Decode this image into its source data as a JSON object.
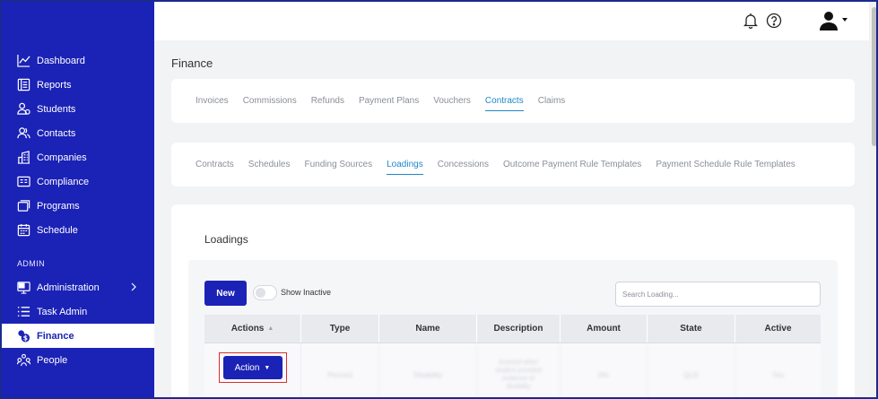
{
  "sidebar": {
    "items": [
      {
        "label": "Dashboard",
        "icon": "chart-line-icon"
      },
      {
        "label": "Reports",
        "icon": "report-icon"
      },
      {
        "label": "Students",
        "icon": "students-icon"
      },
      {
        "label": "Contacts",
        "icon": "contacts-icon"
      },
      {
        "label": "Companies",
        "icon": "companies-icon"
      },
      {
        "label": "Compliance",
        "icon": "compliance-icon"
      },
      {
        "label": "Programs",
        "icon": "programs-icon"
      },
      {
        "label": "Schedule",
        "icon": "calendar-icon"
      }
    ],
    "section_label": "ADMIN",
    "admin_items": [
      {
        "label": "Administration",
        "icon": "monitor-icon"
      },
      {
        "label": "Task Admin",
        "icon": "list-icon"
      },
      {
        "label": "Finance",
        "icon": "finance-icon"
      },
      {
        "label": "People",
        "icon": "people-icon"
      }
    ],
    "colors": {
      "background": "#1b22b6",
      "active_bg": "#ffffff"
    }
  },
  "header": {
    "icons": [
      "bell-icon",
      "help-icon",
      "user-avatar-icon",
      "caret-down-icon"
    ]
  },
  "page": {
    "title": "Finance"
  },
  "finance_tabs": [
    "Invoices",
    "Commissions",
    "Refunds",
    "Payment Plans",
    "Vouchers",
    "Contracts",
    "Claims"
  ],
  "contract_tabs": [
    "Contracts",
    "Schedules",
    "Funding Sources",
    "Loadings",
    "Concessions",
    "Outcome Payment Rule Templates",
    "Payment Schedule Rule Templates"
  ],
  "loadings": {
    "title": "Loadings",
    "new_label": "New",
    "toggle_label": "Show Inactive",
    "search_placeholder": "Search Loading...",
    "columns": [
      "Actions",
      "Type",
      "Name",
      "Description",
      "Amount",
      "State",
      "Active"
    ],
    "row": {
      "action_label": "Action",
      "type": "Percent",
      "name": "Disability",
      "description": [
        "Granted when",
        "student provided",
        "evidence of",
        "disability"
      ],
      "amount": "0%",
      "state": "QLD",
      "active": "Yes"
    }
  },
  "colors": {
    "accent": "#1b22b6",
    "tab_active": "#1e88c8",
    "highlight": "#e02d2d"
  }
}
